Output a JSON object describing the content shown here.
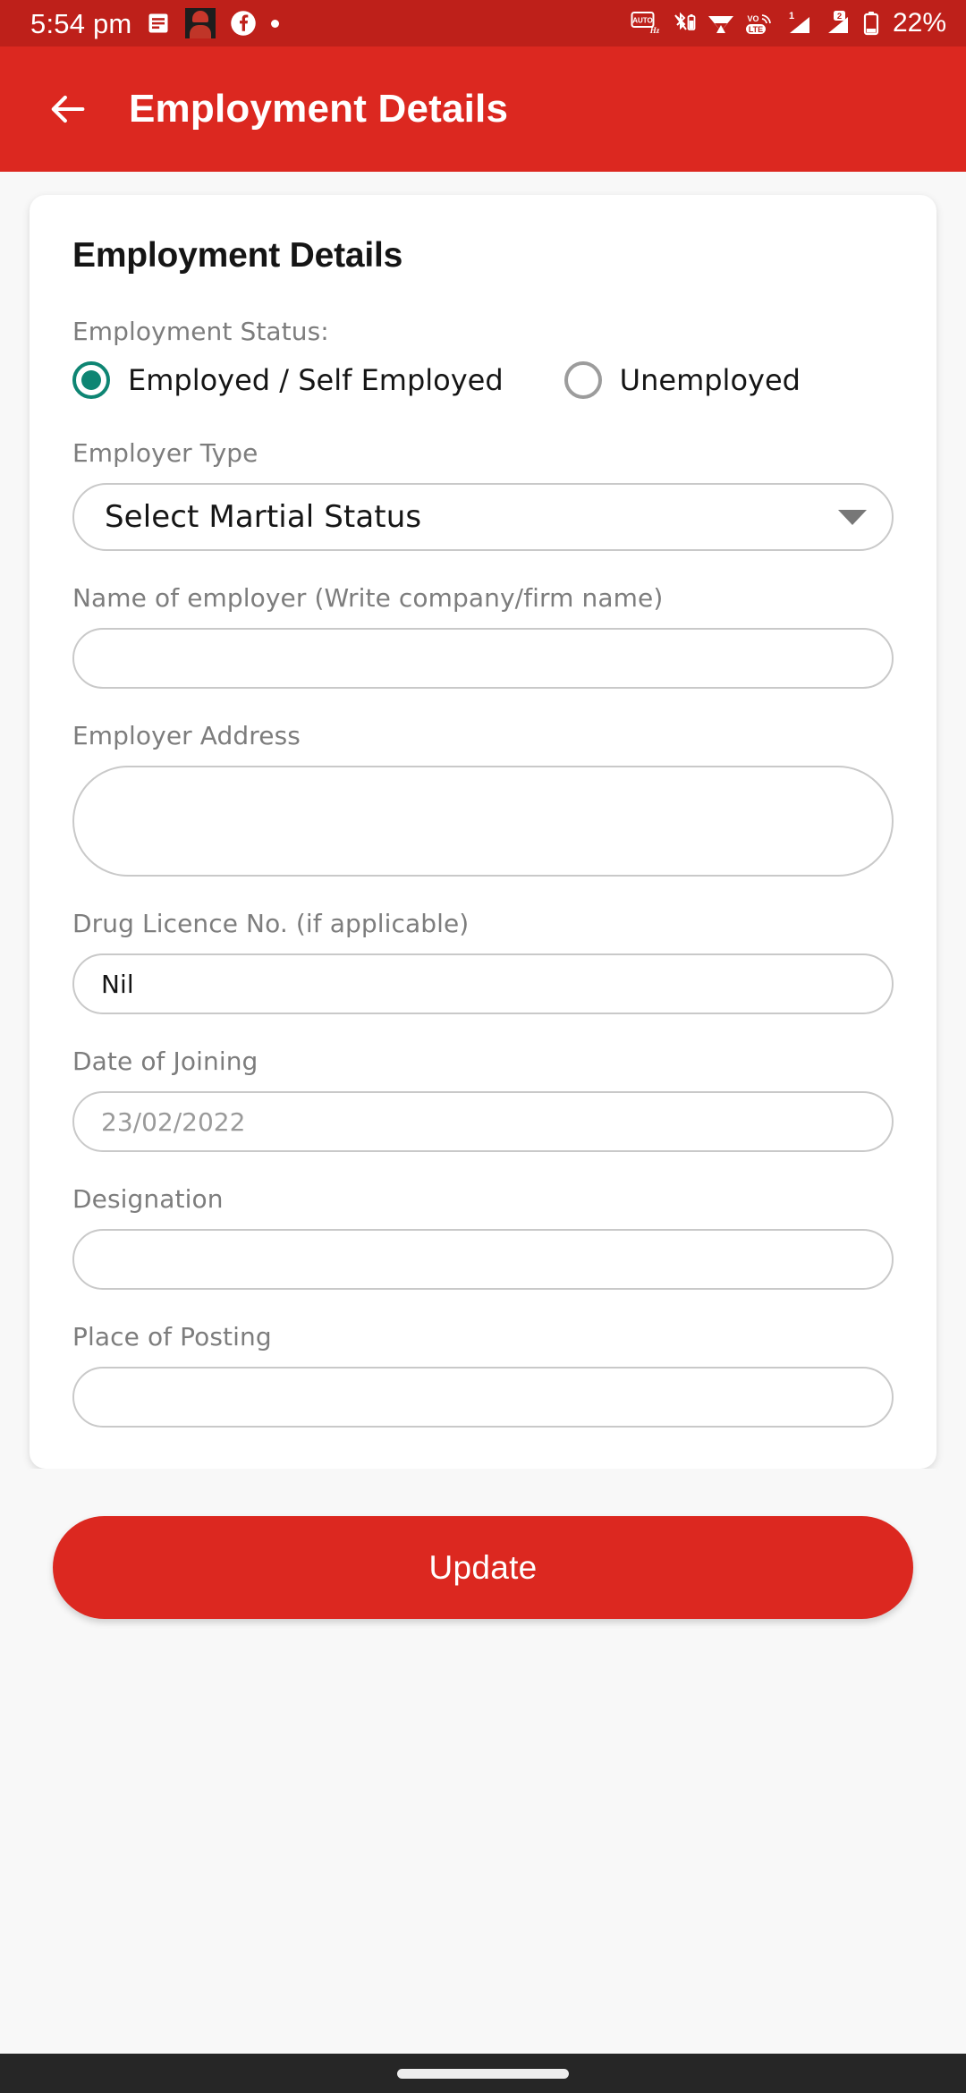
{
  "status_bar": {
    "time": "5:54 pm",
    "battery_percent": "22%",
    "left_icons": [
      "notes-icon",
      "avatar-icon",
      "facebook-icon",
      "dot-icon"
    ],
    "right_icons": [
      "auto-hz-icon",
      "bluetooth-battery-icon",
      "wifi-icon",
      "volte-icon",
      "signal-1-icon",
      "signal-2-icon",
      "battery-icon"
    ],
    "background_color": "#BE201A"
  },
  "app_bar": {
    "title": "Employment Details",
    "back_icon": "arrow-left-icon",
    "background_color": "#DC2820"
  },
  "card": {
    "title": "Employment Details",
    "employment_status": {
      "label": "Employment Status:",
      "options": [
        {
          "label": "Employed / Self Employed",
          "selected": true
        },
        {
          "label": "Unemployed",
          "selected": false
        }
      ],
      "selected_color": "#0E8573"
    },
    "fields": [
      {
        "label": "Employer Type",
        "type": "select",
        "value": "Select Martial Status",
        "filled": false
      },
      {
        "label": "Name of employer (Write company/firm name)",
        "type": "text",
        "value": "",
        "filled": false
      },
      {
        "label": "Employer Address",
        "type": "textarea",
        "value": "",
        "filled": false
      },
      {
        "label": "Drug Licence No. (if applicable)",
        "type": "text",
        "value": "Nil",
        "filled": true
      },
      {
        "label": "Date of Joining",
        "type": "date",
        "value": "23/02/2022",
        "filled": false
      },
      {
        "label": "Designation",
        "type": "text",
        "value": "",
        "filled": false
      },
      {
        "label": "Place of Posting",
        "type": "text",
        "value": "",
        "filled": false
      }
    ]
  },
  "actions": {
    "update_label": "Update",
    "update_color": "#DC2820"
  },
  "nav_bar": {
    "gesture_pill": "home-indicator"
  }
}
